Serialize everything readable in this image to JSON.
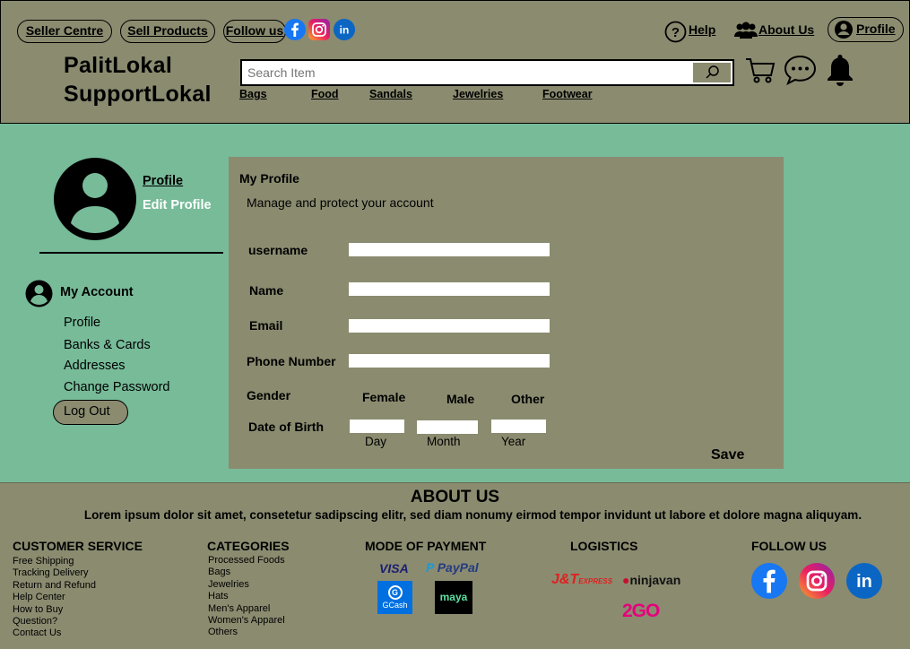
{
  "header": {
    "nav_pills": [
      "Seller Centre",
      "Sell Products",
      "Follow us"
    ],
    "social_icons": [
      "facebook-icon",
      "instagram-icon",
      "linkedin-icon"
    ],
    "help_label": "Help",
    "about_label": "About Us",
    "profile_label": "Profile",
    "brand_line1": "PalitLokal",
    "brand_line2": "SupportLokal",
    "search_placeholder": "Search Item",
    "categories": [
      "Bags",
      "Food",
      "Sandals",
      "Jewelries",
      "Footwear"
    ],
    "icons": [
      "cart-icon",
      "chat-icon",
      "bell-icon"
    ]
  },
  "sidebar": {
    "profile_link": "Profile",
    "edit_profile_link": "Edit Profile",
    "account_heading": "My Account",
    "menu": [
      "Profile",
      "Banks & Cards",
      "Addresses",
      "Change Password"
    ],
    "logout_label": "Log Out"
  },
  "profile_form": {
    "title": "My Profile",
    "subtitle": "Manage and protect your account",
    "username_label": "username",
    "name_label": "Name",
    "email_label": "Email",
    "phone_label": "Phone Number",
    "gender_label": "Gender",
    "gender_options": [
      "Female",
      "Male",
      "Other"
    ],
    "dob_label": "Date of Birth",
    "dob_parts": [
      "Day",
      "Month",
      "Year"
    ],
    "save_label": "Save"
  },
  "about": {
    "title": "ABOUT US",
    "text": "Lorem ipsum dolor sit amet, consetetur sadipscing elitr, sed diam nonumy eirmod tempor invidunt ut labore et dolore magna aliquyam."
  },
  "footer": {
    "customer_service_title": "CUSTOMER SERVICE",
    "customer_service": [
      "Free Shipping",
      "Tracking Delivery",
      "Return and Refund",
      "Help Center",
      "How to Buy",
      "Question?",
      "Contact Us"
    ],
    "categories_title": "CATEGORIES",
    "categories": [
      "Processed Foods",
      "Bags",
      "Jewelries",
      "Hats",
      "Men's Apparel",
      "Women's Apparel",
      "Others"
    ],
    "payment_title": "MODE OF PAYMENT",
    "payment": {
      "visa": "VISA",
      "paypal": "PayPal",
      "gcash": "GCash",
      "maya": "maya"
    },
    "logistics_title": "LOGISTICS",
    "logistics": {
      "jt": "J&T",
      "jt_express": "EXPRESS",
      "ninjavan": "ninjavan",
      "twogo": "2GO"
    },
    "follow_title": "FOLLOW US"
  },
  "colors": {
    "olive": "#8b8b70",
    "mint": "#77bb99",
    "facebook": "#1877f2",
    "linkedin": "#0a66c2"
  }
}
